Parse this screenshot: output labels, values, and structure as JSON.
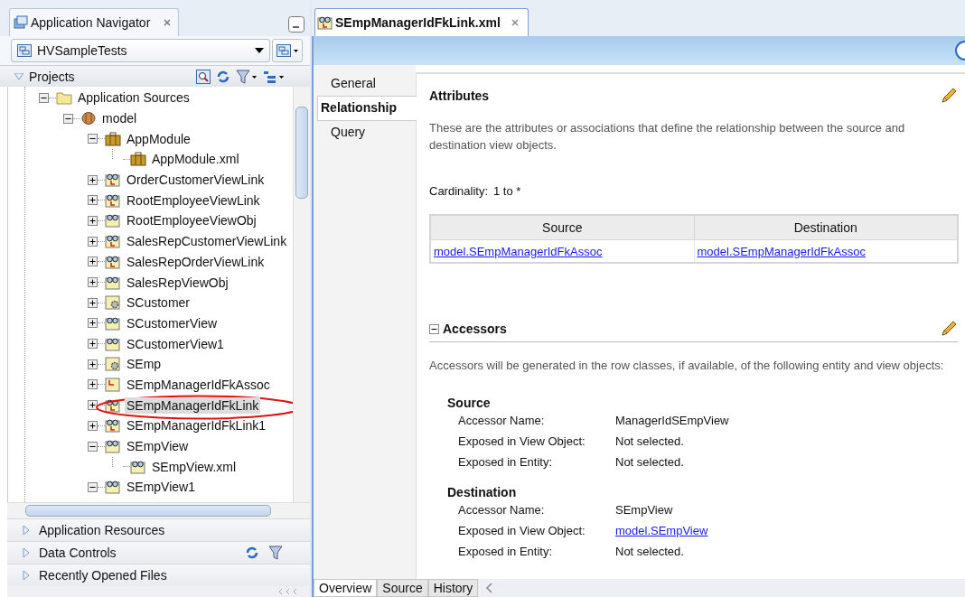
{
  "navigator": {
    "title": "Application Navigator",
    "application": "HVSampleTests",
    "projects_label": "Projects"
  },
  "tree": [
    {
      "label": "Application Sources",
      "kind": "folder",
      "selected": false,
      "expanded": true,
      "children": [
        {
          "label": "model",
          "kind": "package",
          "selected": false,
          "expanded": true,
          "children": [
            {
              "label": "AppModule",
              "kind": "module",
              "selected": false,
              "expanded": true,
              "children": [
                {
                  "label": "AppModule.xml",
                  "kind": "module",
                  "selected": false
                }
              ]
            },
            {
              "label": "OrderCustomerViewLink",
              "kind": "viewlink",
              "selected": false,
              "expanded": false
            },
            {
              "label": "RootEmployeeViewLink",
              "kind": "viewlink",
              "selected": false,
              "expanded": false
            },
            {
              "label": "RootEmployeeViewObj",
              "kind": "viewobject",
              "selected": false,
              "expanded": false
            },
            {
              "label": "SalesRepCustomerViewLink",
              "kind": "viewlink",
              "selected": false,
              "expanded": false
            },
            {
              "label": "SalesRepOrderViewLink",
              "kind": "viewlink",
              "selected": false,
              "expanded": false
            },
            {
              "label": "SalesRepViewObj",
              "kind": "viewobject",
              "selected": false,
              "expanded": false
            },
            {
              "label": "SCustomer",
              "kind": "entity",
              "selected": false,
              "expanded": false
            },
            {
              "label": "SCustomerView",
              "kind": "viewobject",
              "selected": false,
              "expanded": false
            },
            {
              "label": "SCustomerView1",
              "kind": "viewobject",
              "selected": false,
              "expanded": false
            },
            {
              "label": "SEmp",
              "kind": "entity",
              "selected": false,
              "expanded": false
            },
            {
              "label": "SEmpManagerIdFkAssoc",
              "kind": "association",
              "selected": false,
              "expanded": false
            },
            {
              "label": "SEmpManagerIdFkLink",
              "kind": "viewlink",
              "selected": true,
              "expanded": false
            },
            {
              "label": "SEmpManagerIdFkLink1",
              "kind": "viewlink",
              "selected": false,
              "expanded": false
            },
            {
              "label": "SEmpView",
              "kind": "viewobject",
              "selected": false,
              "expanded": true,
              "children": [
                {
                  "label": "SEmpView.xml",
                  "kind": "viewobject",
                  "selected": false
                }
              ]
            },
            {
              "label": "SEmpView1",
              "kind": "viewobject",
              "selected": false,
              "expanded": true
            }
          ]
        }
      ]
    }
  ],
  "accordions": [
    {
      "label": "Application Resources",
      "expanded": false,
      "tools": false
    },
    {
      "label": "Data Controls",
      "expanded": false,
      "tools": true
    },
    {
      "label": "Recently Opened Files",
      "expanded": false,
      "tools": false
    }
  ],
  "editor": {
    "tab": "SEmpManagerIdFkLink.xml"
  },
  "side_tabs": [
    {
      "label": "General",
      "selected": false
    },
    {
      "label": "Relationship",
      "selected": true
    },
    {
      "label": "Query",
      "selected": false
    }
  ],
  "attributes": {
    "title": "Attributes",
    "description": "These are the attributes or associations that define the relationship between the source and destination view objects.",
    "cardinality_label": "Cardinality:",
    "cardinality": "1 to *",
    "columns": [
      "Source",
      "Destination"
    ],
    "rows": [
      [
        "model.SEmpManagerIdFkAssoc",
        "model.SEmpManagerIdFkAssoc"
      ]
    ]
  },
  "accessors": {
    "title": "Accessors",
    "expanded": true,
    "description": "Accessors will be generated in the row classes, if available, of the following entity and view objects:",
    "groups": [
      {
        "title": "Source",
        "fields": [
          {
            "label": "Accessor Name:",
            "value": "ManagerIdSEmpView",
            "kind": "text"
          },
          {
            "label": "Exposed in View Object:",
            "value": "Not selected.",
            "kind": "text"
          },
          {
            "label": "Exposed in Entity:",
            "value": "Not selected.",
            "kind": "text"
          }
        ]
      },
      {
        "title": "Destination",
        "fields": [
          {
            "label": "Accessor Name:",
            "value": "SEmpView",
            "kind": "text"
          },
          {
            "label": "Exposed in View Object:",
            "value": "model.SEmpView",
            "kind": "link"
          },
          {
            "label": "Exposed in Entity:",
            "value": "Not selected.",
            "kind": "text"
          }
        ]
      }
    ]
  },
  "bottom_tabs": [
    {
      "label": "Overview",
      "selected": true
    },
    {
      "label": "Source",
      "selected": false
    },
    {
      "label": "History",
      "selected": false
    }
  ]
}
